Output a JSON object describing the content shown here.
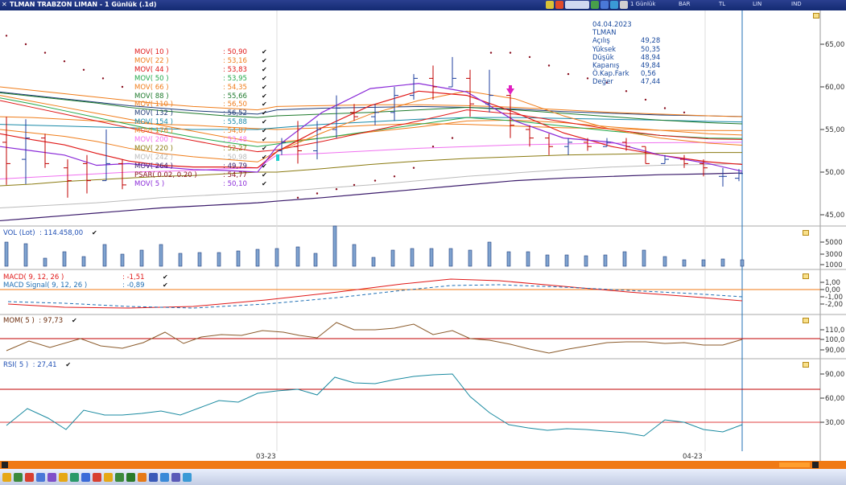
{
  "window": {
    "title": "TLMAN TRABZON LIMAN - 1 Günlük (.1d)"
  },
  "toolbar_top": {
    "period": "1 Günlük",
    "type": "BAR",
    "currency": "TL",
    "scale": "LIN",
    "ind": "IND"
  },
  "info": {
    "date": "04.04.2023",
    "symbol": "TLMAN",
    "rows": [
      {
        "k": "Açılış",
        "v": "49,28"
      },
      {
        "k": "Yüksek",
        "v": "50,35"
      },
      {
        "k": "Düşük",
        "v": "48,94"
      },
      {
        "k": "Kapanış",
        "v": "49,84"
      },
      {
        "k": "Ö.Kap.Fark",
        "v": "0,56"
      },
      {
        "k": "Değer",
        "v": "47,44"
      }
    ]
  },
  "legend": [
    {
      "name": "MOV( 10 )",
      "value": ": 50,90",
      "color": "#e01818"
    },
    {
      "name": "MOV( 22 )",
      "value": ": 53,16",
      "color": "#f07d1a"
    },
    {
      "name": "MOV( 44 )",
      "value": ": 53,83",
      "color": "#e01818"
    },
    {
      "name": "MOV( 50 )",
      "value": ": 53,95",
      "color": "#22a84a"
    },
    {
      "name": "MOV( 66 )",
      "value": ": 54,35",
      "color": "#f07d1a"
    },
    {
      "name": "MOV( 88 )",
      "value": ": 55,66",
      "color": "#1e7a2c"
    },
    {
      "name": "MOV( 110 )",
      "value": ": 56,50",
      "color": "#f07d1a"
    },
    {
      "name": "MOV( 132 )",
      "value": ": 56,52",
      "color": "#203c78"
    },
    {
      "name": "MOV( 154 )",
      "value": ": 55,88",
      "color": "#1a8aa8"
    },
    {
      "name": "MOV( 176 )",
      "value": ": 54,87",
      "color": "#f07d1a"
    },
    {
      "name": "MOV( 200 )",
      "value": ": 53,48",
      "color": "#f070f0"
    },
    {
      "name": "MOV( 220 )",
      "value": ": 52,27",
      "color": "#8a7a10"
    },
    {
      "name": "MOV( 242 )",
      "value": ": 50,98",
      "color": "#bbbbbb"
    },
    {
      "name": "MOV( 264 )",
      "value": ": 49,79",
      "color": "#3a1a6a"
    },
    {
      "name": "PSAR( 0.02, 0.20 )",
      "value": ": 54,77",
      "color": "#8a1020"
    },
    {
      "name": "MOV( 5 )",
      "value": ": 50,10",
      "color": "#8a2ad8"
    }
  ],
  "panels": {
    "vol": {
      "label": "VOL (Lot)",
      "value": ": 114.458,00"
    },
    "macd": {
      "label": "MACD( 9, 12, 26 )",
      "value": ": -1,51"
    },
    "macd_signal": {
      "label": "MACD Signal( 9, 12, 26 )",
      "value": ": -0,89"
    },
    "mom": {
      "label": "MOM( 5 )",
      "value": ": 97,73"
    },
    "rsi": {
      "label": "RSI( 5 )",
      "value": ": 27,41"
    }
  },
  "axes": {
    "price": [
      "65,00",
      "60,00",
      "55,00",
      "50,00",
      "45,00"
    ],
    "vol": [
      "5000",
      "3000",
      "1000"
    ],
    "macd": [
      "1,00",
      "0,00",
      "-1,00",
      "-2,00"
    ],
    "mom": [
      "110,0",
      "100,0",
      "90,00"
    ],
    "rsi": [
      "90,00",
      "60,00",
      "30,00"
    ],
    "dates": [
      "03-23",
      "04-23"
    ]
  },
  "colors": {
    "accent": "#1f4fb4",
    "hline": "#c00000",
    "orangebar": "#f07a14"
  },
  "icons": [
    "pencil-icon",
    "close-icon",
    "scroll-left-icon",
    "scroll-right-icon"
  ]
}
